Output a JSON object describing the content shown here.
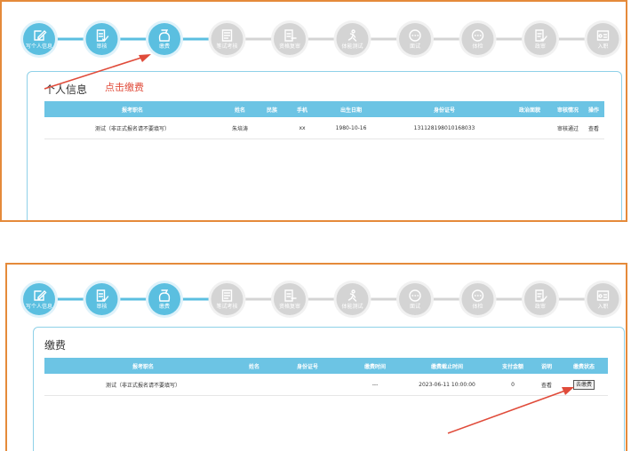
{
  "steps": [
    {
      "label": "写个人信息",
      "icon": "edit-icon",
      "active": true
    },
    {
      "label": "审核",
      "icon": "checklist-icon",
      "active": true
    },
    {
      "label": "缴费",
      "icon": "money-bag-icon",
      "active": true
    },
    {
      "label": "笔试考核",
      "icon": "exam-icon",
      "active": false
    },
    {
      "label": "资格复审",
      "icon": "review-icon",
      "active": false
    },
    {
      "label": "体能测试",
      "icon": "runner-icon",
      "active": false
    },
    {
      "label": "面试",
      "icon": "chat-icon",
      "active": false
    },
    {
      "label": "体检",
      "icon": "chat-icon",
      "active": false
    },
    {
      "label": "政审",
      "icon": "doc-check-icon",
      "active": false
    },
    {
      "label": "入职",
      "icon": "id-card-icon",
      "active": false
    }
  ],
  "colors": {
    "active": "#5bbfe0",
    "inactive": "#d4d4d4",
    "accent": "#e04b3a",
    "border": "#e58a3a"
  },
  "panel1": {
    "title": "个人信息",
    "hint": "点击缴费",
    "headers": [
      "报考职名",
      "姓名",
      "民族",
      "手机",
      "出生日期",
      "身份证号",
      "政治面貌",
      "审核情况",
      "操作"
    ],
    "row": [
      "测试（非正式报名请不要填写）",
      "朱培涛",
      "",
      "xx",
      "1980-10-16",
      "131128198010168033",
      "",
      "审核通过",
      "查看"
    ]
  },
  "panel2": {
    "title": "缴费",
    "headers": [
      "报考职名",
      "姓名",
      "身份证号",
      "缴费时间",
      "缴费截止时间",
      "支付金额",
      "说明",
      "缴费状态"
    ],
    "row": [
      "测试（非正式报名请不要填写）",
      "",
      "",
      "---",
      "2023-06-11 10:00:00",
      "0",
      "查看",
      "去缴费"
    ]
  }
}
